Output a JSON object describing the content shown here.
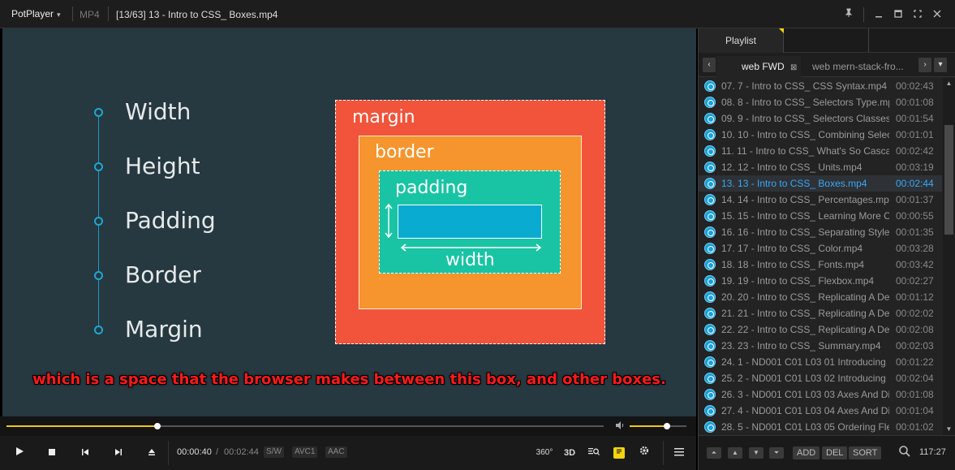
{
  "titlebar": {
    "app_name": "PotPlayer",
    "format": "MP4",
    "file_title": "[13/63] 13 - Intro to CSS_ Boxes.mp4"
  },
  "video": {
    "bullets": [
      "Width",
      "Height",
      "Padding",
      "Border",
      "Margin"
    ],
    "box_labels": {
      "margin": "margin",
      "border": "border",
      "padding": "padding",
      "width": "width"
    },
    "subtitle": "which is a space that the browser makes between this box, and other boxes.",
    "colors": {
      "margin": "#f1543a",
      "border": "#f6952d",
      "padding": "#19c4a4",
      "content": "#0aabd0",
      "background": "#263840"
    }
  },
  "seek": {
    "progress": 0.253,
    "volume": 0.66
  },
  "controls": {
    "time_current": "00:00:40",
    "time_separator": "/",
    "time_total": "00:02:44",
    "tags": [
      "S/W",
      "AVC1",
      "AAC"
    ],
    "icon_360": "360°",
    "icon_3d": "3D"
  },
  "panel": {
    "tab_label": "Playlist",
    "playlist_tabs": [
      "web FWD",
      "web mern-stack-fro..."
    ],
    "items": [
      {
        "title": "07. 7 - Intro to CSS_ CSS Syntax.mp4",
        "duration": "00:02:43"
      },
      {
        "title": "08. 8 - Intro to CSS_ Selectors Type.mp4",
        "duration": "00:01:08"
      },
      {
        "title": "09. 9 - Intro to CSS_ Selectors Classes ...",
        "duration": "00:01:54"
      },
      {
        "title": "10. 10 - Intro to CSS_ Combining Selec...",
        "duration": "00:01:01"
      },
      {
        "title": "11. 11 - Intro to CSS_ What's So Casca...",
        "duration": "00:02:42"
      },
      {
        "title": "12. 12 - Intro to CSS_ Units.mp4",
        "duration": "00:03:19"
      },
      {
        "title": "13. 13 - Intro to CSS_ Boxes.mp4",
        "duration": "00:02:44",
        "active": true
      },
      {
        "title": "14. 14 - Intro to CSS_ Percentages.mp4",
        "duration": "00:01:37"
      },
      {
        "title": "15. 15 - Intro to CSS_ Learning More C...",
        "duration": "00:00:55"
      },
      {
        "title": "16. 16 - Intro to CSS_ Separating Style...",
        "duration": "00:01:35"
      },
      {
        "title": "17. 17 - Intro to CSS_ Color.mp4",
        "duration": "00:03:28"
      },
      {
        "title": "18. 18 - Intro to CSS_ Fonts.mp4",
        "duration": "00:03:42"
      },
      {
        "title": "19. 19 - Intro to CSS_ Flexbox.mp4",
        "duration": "00:02:27"
      },
      {
        "title": "20. 20 - Intro to CSS_ Replicating A De...",
        "duration": "00:01:12"
      },
      {
        "title": "21. 21 - Intro to CSS_ Replicating A De...",
        "duration": "00:02:02"
      },
      {
        "title": "22. 22 - Intro to CSS_ Replicating A De...",
        "duration": "00:02:08"
      },
      {
        "title": "23. 23 - Intro to CSS_ Summary.mp4",
        "duration": "00:02:03"
      },
      {
        "title": "24. 1 - ND001 C01 L03 01 Introducing ...",
        "duration": "00:01:22"
      },
      {
        "title": "25. 2 - ND001 C01 L03 02 Introducing ...",
        "duration": "00:02:04"
      },
      {
        "title": "26. 3 - ND001 C01 L03 03 Axes And Dir...",
        "duration": "00:01:08"
      },
      {
        "title": "27. 4 - ND001 C01 L03 04 Axes And Dir...",
        "duration": "00:01:04"
      },
      {
        "title": "28. 5 - ND001 C01 L03 05 Ordering Fle...",
        "duration": "00:01:02"
      }
    ],
    "bottom": {
      "add": "ADD",
      "del": "DEL",
      "sort": "SORT",
      "total": "117:27"
    }
  }
}
